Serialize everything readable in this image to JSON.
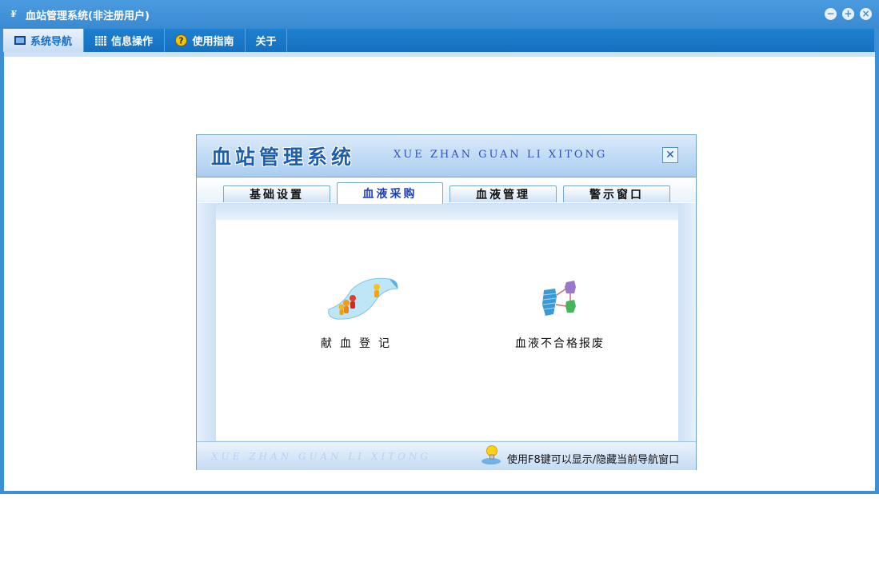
{
  "window": {
    "title": "血站管理系统(非注册用户)",
    "app_icon": "app-logo-icon"
  },
  "menu": [
    {
      "label": "系统导航",
      "icon": "monitor-icon",
      "active": true
    },
    {
      "label": "信息操作",
      "icon": "grid-icon",
      "active": false
    },
    {
      "label": "使用指南",
      "icon": "help-icon",
      "active": false
    },
    {
      "label": "关于",
      "icon": "",
      "active": false
    }
  ],
  "panel": {
    "title": "血站管理系统",
    "subtitle": "XUE ZHAN GUAN LI XITONG",
    "tabs": [
      "基础设置",
      "血液采购",
      "血液管理",
      "警示窗口"
    ],
    "active_tab": 1,
    "items": [
      {
        "label": "献血登记",
        "icon": "donor-registration-icon"
      },
      {
        "label": "血液不合格报废",
        "icon": "blood-scrap-icon"
      }
    ],
    "footer_watermark": "XUE ZHAN GUAN LI XITONG",
    "footer_hint": "使用F8键可以显示/隐藏当前导航窗口"
  },
  "colors": {
    "titlebar": "#3d8fd6",
    "menubar": "#1670c0",
    "active_tab_text": "#1b3fbf"
  }
}
